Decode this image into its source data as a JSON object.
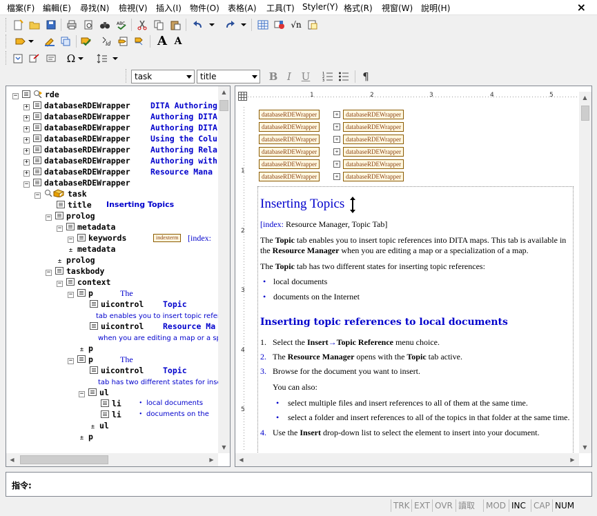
{
  "menubar": {
    "items": [
      "檔案(F)",
      "編輯(E)",
      "尋找(N)",
      "檢視(V)",
      "插入(I)",
      "物件(O)",
      "表格(A)",
      "工具(T)",
      "Styler(Y)",
      "格式(R)",
      "視窗(W)",
      "說明(H)"
    ],
    "close_glyph": "×"
  },
  "toolbar": {
    "element_combo": "task",
    "style_combo": "title",
    "bold": "B",
    "italic": "I",
    "underline": "U",
    "pilcrow": "¶",
    "font_big": "A",
    "font_small": "A",
    "omega": "Ω",
    "sqrt": "√n"
  },
  "tree": {
    "root": "rde",
    "wrappers": [
      {
        "node": "databaseRDEWrapper",
        "text": "DITA Authoring"
      },
      {
        "node": "databaseRDEWrapper",
        "text": "Authoring DITA"
      },
      {
        "node": "databaseRDEWrapper",
        "text": "Authoring DITA"
      },
      {
        "node": "databaseRDEWrapper",
        "text": "Using the Colu"
      },
      {
        "node": "databaseRDEWrapper",
        "text": "Authoring Rela"
      },
      {
        "node": "databaseRDEWrapper",
        "text": "Authoring with"
      },
      {
        "node": "databaseRDEWrapper",
        "text": "Resource Mana"
      },
      {
        "node": "databaseRDEWrapper",
        "text": ""
      }
    ],
    "task": "task",
    "title_node": "title",
    "title_text": "Inserting Topics",
    "prolog": "prolog",
    "metadata": "metadata",
    "keywords": "keywords",
    "indexterm_tag": "indexterm",
    "indexterm_text": "[index:",
    "metadata_end": "metadata",
    "prolog_end": "prolog",
    "taskbody": "taskbody",
    "context": "context",
    "p": "p",
    "p_text_1": "The",
    "uicontrol": "uicontrol",
    "topic_text": "Topic",
    "p_text_2": "tab enables you to insert topic refere",
    "resource_text": "Resource Ma",
    "p_text_3": "when you are editing a map or a sp",
    "p_end": "p",
    "p2": "p",
    "p2_text_1": "The",
    "uicontrol2": "uicontrol",
    "topic_text2": "Topic",
    "p2_text_2": "tab has two different states for inser",
    "ul": "ul",
    "li1": "li",
    "li1_text": "local documents",
    "li2": "li",
    "li2_text": "documents on the",
    "ul_end": "ul",
    "p3": "p"
  },
  "ruler": {
    "h_labels": [
      "1",
      "2",
      "3",
      "4",
      "5"
    ],
    "v_labels": [
      "1",
      "2",
      "3",
      "4",
      "5"
    ]
  },
  "doc": {
    "wrapper_label": "databaseRDEWrapper",
    "title": "Inserting Topics",
    "index_line_prefix": "[index:",
    "index_line_rest": " Resource Manager, Topic Tab]",
    "p1_a": "The ",
    "p1_b": "Topic",
    "p1_c": " tab enables you to insert topic references into DITA maps. This tab is available in",
    "p1_d": "the ",
    "p1_e": "Resource Manager",
    "p1_f": " when you are editing a map or a specialization of a map.",
    "p2_a": "The ",
    "p2_b": "Topic",
    "p2_c": " tab has two different states for inserting topic references:",
    "bullet1": "local documents",
    "bullet2": "documents on the Internet",
    "h2": "Inserting topic references to local documents",
    "step1_num": "1.",
    "step1_a": "Select the ",
    "step1_b": "Insert",
    "step1_arrow": "→",
    "step1_c": "Topic Reference",
    "step1_d": " menu choice.",
    "step2_num": "2.",
    "step2_a": "The ",
    "step2_b": "Resource Manager",
    "step2_c": " opens with the ",
    "step2_d": "Topic",
    "step2_e": " tab active.",
    "step3_num": "3.",
    "step3_a": "Browse for the document you want to insert.",
    "step3_sub": "You can also:",
    "sub1": "select multiple files and insert references to all of them at the same time.",
    "sub2": "select a folder and insert references to all of the topics in that folder at the same time.",
    "step4_num": "4.",
    "step4_a": "Use the ",
    "step4_b": "Insert",
    "step4_c": " drop-down list to select the element to insert into your document."
  },
  "command": {
    "label": "指令:"
  },
  "status": {
    "indicators": [
      "TRK",
      "EXT",
      "OVR",
      "讀取",
      "MOD",
      "INC",
      "CAP",
      "NUM"
    ],
    "active": [
      "INC",
      "NUM"
    ]
  },
  "colors": {
    "link_blue": "#0000cc",
    "wrapper_brown": "#8b4513"
  }
}
